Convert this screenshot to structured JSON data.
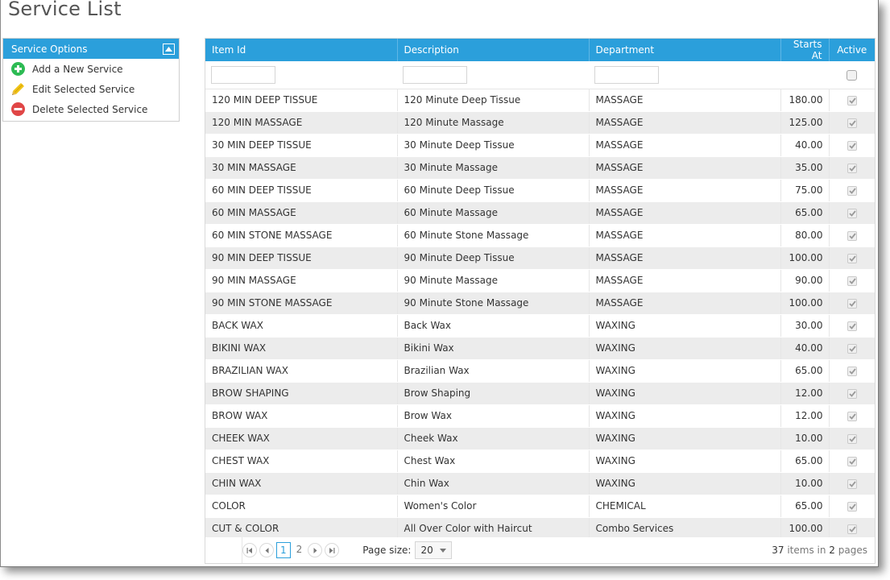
{
  "page": {
    "title": "Service List"
  },
  "options_panel": {
    "title": "Service Options",
    "items": [
      {
        "label": "Add a New Service",
        "icon": "plus-circle-icon",
        "color": "#2dbb54"
      },
      {
        "label": "Edit Selected Service",
        "icon": "pencil-icon",
        "color": "#f0c419"
      },
      {
        "label": "Delete Selected Service",
        "icon": "minus-circle-icon",
        "color": "#e04646"
      }
    ]
  },
  "grid": {
    "columns": [
      {
        "key": "item_id",
        "label": "Item Id"
      },
      {
        "key": "description",
        "label": "Description"
      },
      {
        "key": "department",
        "label": "Department"
      },
      {
        "key": "starts_at",
        "label": "Starts At"
      },
      {
        "key": "active",
        "label": "Active"
      }
    ],
    "filters": {
      "item_id": "",
      "description": "",
      "department": "",
      "active": false
    },
    "rows": [
      {
        "item_id": "120 MIN DEEP TISSUE",
        "description": "120 Minute Deep Tissue",
        "department": "MASSAGE",
        "starts_at": "180.00",
        "active": true
      },
      {
        "item_id": "120 MIN MASSAGE",
        "description": "120 Minute Massage",
        "department": "MASSAGE",
        "starts_at": "125.00",
        "active": true
      },
      {
        "item_id": "30 MIN DEEP TISSUE",
        "description": "30 Minute Deep Tissue",
        "department": "MASSAGE",
        "starts_at": "40.00",
        "active": true
      },
      {
        "item_id": "30 MIN MASSAGE",
        "description": "30 Minute Massage",
        "department": "MASSAGE",
        "starts_at": "35.00",
        "active": true
      },
      {
        "item_id": "60 MIN DEEP TISSUE",
        "description": "60 Minute Deep Tissue",
        "department": "MASSAGE",
        "starts_at": "75.00",
        "active": true
      },
      {
        "item_id": "60 MIN MASSAGE",
        "description": "60 Minute Massage",
        "department": "MASSAGE",
        "starts_at": "65.00",
        "active": true
      },
      {
        "item_id": "60 MIN STONE MASSAGE",
        "description": "60 Minute Stone Massage",
        "department": "MASSAGE",
        "starts_at": "80.00",
        "active": true
      },
      {
        "item_id": "90 MIN DEEP TISSUE",
        "description": "90 Minute Deep Tissue",
        "department": "MASSAGE",
        "starts_at": "100.00",
        "active": true
      },
      {
        "item_id": "90 MIN MASSAGE",
        "description": "90 Minute Massage",
        "department": "MASSAGE",
        "starts_at": "90.00",
        "active": true
      },
      {
        "item_id": "90 MIN STONE MASSAGE",
        "description": "90 Minute Stone Massage",
        "department": "MASSAGE",
        "starts_at": "100.00",
        "active": true
      },
      {
        "item_id": "BACK WAX",
        "description": "Back Wax",
        "department": "WAXING",
        "starts_at": "30.00",
        "active": true
      },
      {
        "item_id": "BIKINI WAX",
        "description": "Bikini Wax",
        "department": "WAXING",
        "starts_at": "40.00",
        "active": true
      },
      {
        "item_id": "BRAZILIAN WAX",
        "description": "Brazilian Wax",
        "department": "WAXING",
        "starts_at": "65.00",
        "active": true
      },
      {
        "item_id": "BROW SHAPING",
        "description": "Brow Shaping",
        "department": "WAXING",
        "starts_at": "12.00",
        "active": true
      },
      {
        "item_id": "BROW WAX",
        "description": "Brow Wax",
        "department": "WAXING",
        "starts_at": "12.00",
        "active": true
      },
      {
        "item_id": "CHEEK WAX",
        "description": "Cheek Wax",
        "department": "WAXING",
        "starts_at": "10.00",
        "active": true
      },
      {
        "item_id": "CHEST WAX",
        "description": "Chest Wax",
        "department": "WAXING",
        "starts_at": "65.00",
        "active": true
      },
      {
        "item_id": "CHIN WAX",
        "description": "Chin Wax",
        "department": "WAXING",
        "starts_at": "10.00",
        "active": true
      },
      {
        "item_id": "COLOR",
        "description": "Women's Color",
        "department": "CHEMICAL",
        "starts_at": "65.00",
        "active": true
      },
      {
        "item_id": "CUT & COLOR",
        "description": "All Over Color with Haircut",
        "department": "Combo Services",
        "starts_at": "100.00",
        "active": true
      }
    ]
  },
  "pager": {
    "pages": [
      "1",
      "2"
    ],
    "current_page": "1",
    "page_size_label": "Page size:",
    "page_size": "20",
    "info": {
      "total_items": "37",
      "items_text": "items in",
      "total_pages": "2",
      "pages_text": "pages"
    }
  },
  "colors": {
    "accent": "#2b9fdb",
    "alt_row": "#ececec"
  }
}
